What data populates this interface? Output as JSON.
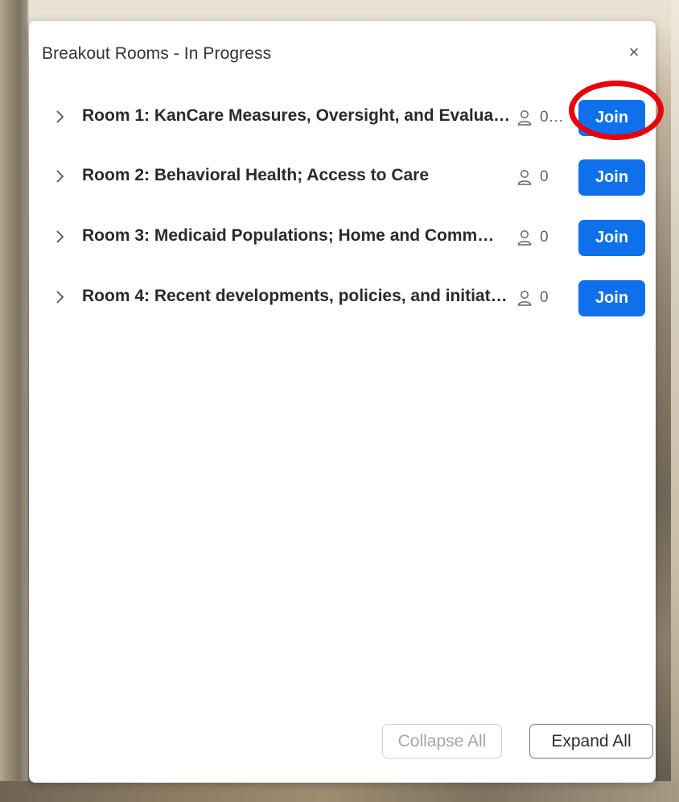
{
  "dialog": {
    "title": "Breakout Rooms - In Progress",
    "close_label": "×"
  },
  "rooms": [
    {
      "name": "Room 1: KanCare Measures, Oversight, and Evalua…",
      "count": "0…",
      "join_label": "Join",
      "highlighted": true
    },
    {
      "name": "Room 2: Behavioral Health; Access to Care",
      "count": "0",
      "join_label": "Join",
      "highlighted": false
    },
    {
      "name": "Room 3: Medicaid Populations; Home and Comm…",
      "count": "0",
      "join_label": "Join",
      "highlighted": false
    },
    {
      "name": "Room 4: Recent developments, policies, and initiat…",
      "count": "0",
      "join_label": "Join",
      "highlighted": false
    }
  ],
  "footer": {
    "collapse_label": "Collapse All",
    "expand_label": "Expand All"
  },
  "colors": {
    "join_button": "#0e71eb",
    "highlight_ring": "#e8000b"
  },
  "icons": {
    "expand": "chevron-right-icon",
    "participants": "person-icon",
    "close": "close-icon"
  }
}
